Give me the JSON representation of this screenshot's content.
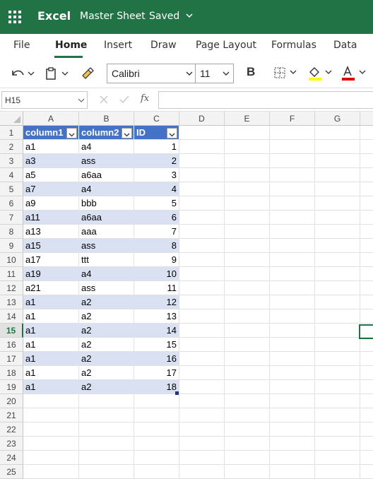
{
  "titlebar": {
    "app_name": "Excel",
    "doc_name": "Master Sheet",
    "separator": "-",
    "status": "Saved",
    "icons": [
      "app-launcher-icon",
      "chevron-down-icon"
    ]
  },
  "tabs": [
    {
      "label": "File"
    },
    {
      "label": "Home",
      "active": true
    },
    {
      "label": "Insert"
    },
    {
      "label": "Draw"
    },
    {
      "label": "Page Layout"
    },
    {
      "label": "Formulas"
    },
    {
      "label": "Data"
    }
  ],
  "toolbar": {
    "font_name": "Calibri",
    "font_size": "11",
    "bold_label": "B",
    "icons": [
      "undo-icon",
      "paste-icon",
      "format-painter-icon",
      "borders-icon",
      "fill-color-icon",
      "font-color-icon"
    ],
    "fill_color": "#ffff00",
    "font_color": "#e00000"
  },
  "formula_bar": {
    "name_box": "H15",
    "fx_label": "fx",
    "formula": ""
  },
  "sheet": {
    "columns": [
      "A",
      "B",
      "C",
      "D",
      "E",
      "F",
      "G"
    ],
    "selected_row": "15",
    "table_headers": [
      "column1",
      "column2",
      "ID"
    ],
    "rows": [
      [
        "a1",
        "a4",
        "1"
      ],
      [
        "a3",
        "ass",
        "2"
      ],
      [
        "a5",
        "a6aa",
        "3"
      ],
      [
        "a7",
        "a4",
        "4"
      ],
      [
        "a9",
        "bbb",
        "5"
      ],
      [
        "a11",
        "a6aa",
        "6"
      ],
      [
        "a13",
        "aaa",
        "7"
      ],
      [
        "a15",
        "ass",
        "8"
      ],
      [
        "a17",
        "ttt",
        "9"
      ],
      [
        "a19",
        "a4",
        "10"
      ],
      [
        "a21",
        "ass",
        "11"
      ],
      [
        "a1",
        "a2",
        "12"
      ],
      [
        "a1",
        "a2",
        "13"
      ],
      [
        "a1",
        "a2",
        "14"
      ],
      [
        "a1",
        "a2",
        "15"
      ],
      [
        "a1",
        "a2",
        "16"
      ],
      [
        "a1",
        "a2",
        "17"
      ],
      [
        "a1",
        "a2",
        "18"
      ]
    ],
    "row_numbers": [
      "1",
      "2",
      "3",
      "4",
      "5",
      "6",
      "7",
      "8",
      "9",
      "10",
      "11",
      "12",
      "13",
      "14",
      "15",
      "16",
      "17",
      "18",
      "19",
      "20",
      "21",
      "22",
      "23",
      "24",
      "25"
    ],
    "colors": {
      "header_fill": "#4472c4",
      "band_fill": "#d9e1f2",
      "accent": "#217346"
    }
  }
}
